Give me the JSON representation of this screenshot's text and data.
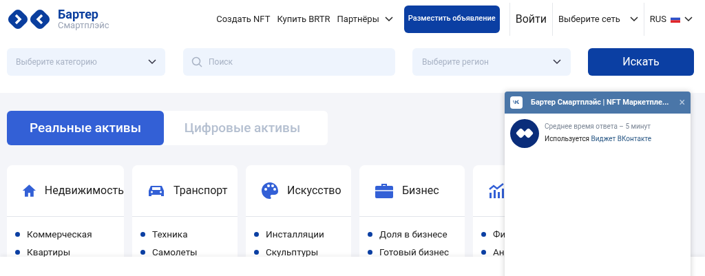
{
  "logo": {
    "name": "Бартер",
    "tagline": "Смартплэйс"
  },
  "nav": [
    {
      "label": "Создать NFT",
      "kind": "link"
    },
    {
      "label": "Купить BRTR",
      "kind": "link"
    },
    {
      "label": "Партнёры",
      "kind": "dropdown"
    }
  ],
  "post_button": "Разместить объявление",
  "login": "Войти",
  "network_select": "Выберите сеть",
  "language": "RUS",
  "search": {
    "category_placeholder": "Выберите категорию",
    "query_placeholder": "Поиск",
    "region_placeholder": "Выберите регион",
    "button": "Искать"
  },
  "tabs": [
    {
      "label": "Реальные активы",
      "selected": true
    },
    {
      "label": "Цифровые активы",
      "selected": false
    }
  ],
  "categories": [
    {
      "title": "Недвижимость",
      "kind": "house",
      "items": [
        "Коммерческая",
        "Квартиры"
      ]
    },
    {
      "title": "Транспорт",
      "kind": "car",
      "items": [
        "Техника",
        "Самолеты"
      ]
    },
    {
      "title": "Искусство",
      "kind": "palette",
      "items": [
        "Инсталляции",
        "Скульптуры"
      ]
    },
    {
      "title": "Бизнес",
      "kind": "briefcase",
      "items": [
        "Доля в бизнесе",
        "Готовый бизнес"
      ]
    },
    {
      "kind": "chart",
      "items": [
        "Фи",
        "Ан"
      ]
    }
  ],
  "chat_widget": {
    "title": "Бартер Смартплэйс | NFT Маркетпле...",
    "close": "×",
    "response_time": "Среднее время ответа – 5 минут",
    "powered_prefix": "Используется",
    "powered_link": "Виджет ВКонтакте"
  }
}
